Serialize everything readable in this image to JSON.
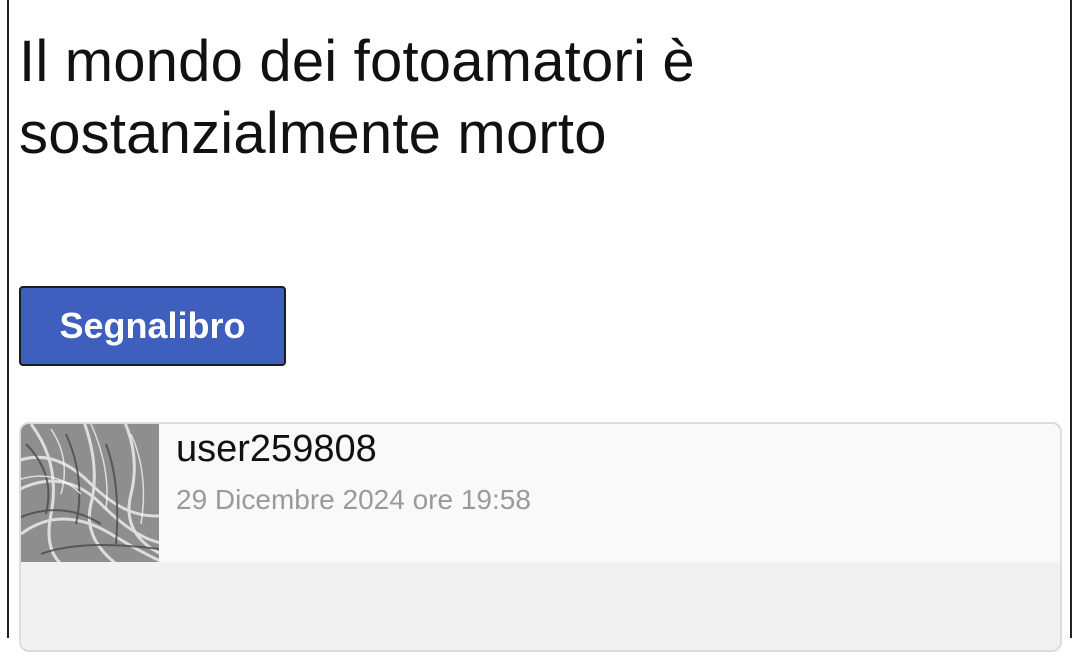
{
  "article": {
    "title_line1": "Il mondo dei fotoamatori è",
    "title_line2": "sostanzialmente morto"
  },
  "actions": {
    "bookmark_label": "Segnalibro"
  },
  "comment": {
    "username": "user259808",
    "timestamp": "29 Dicembre 2024 ore 19:58",
    "avatar_icon": "user-avatar-photo"
  },
  "colors": {
    "button_bg": "#3f5fbf",
    "timestamp_text": "#9a9a9a",
    "card_bg": "#f9f9f9"
  }
}
